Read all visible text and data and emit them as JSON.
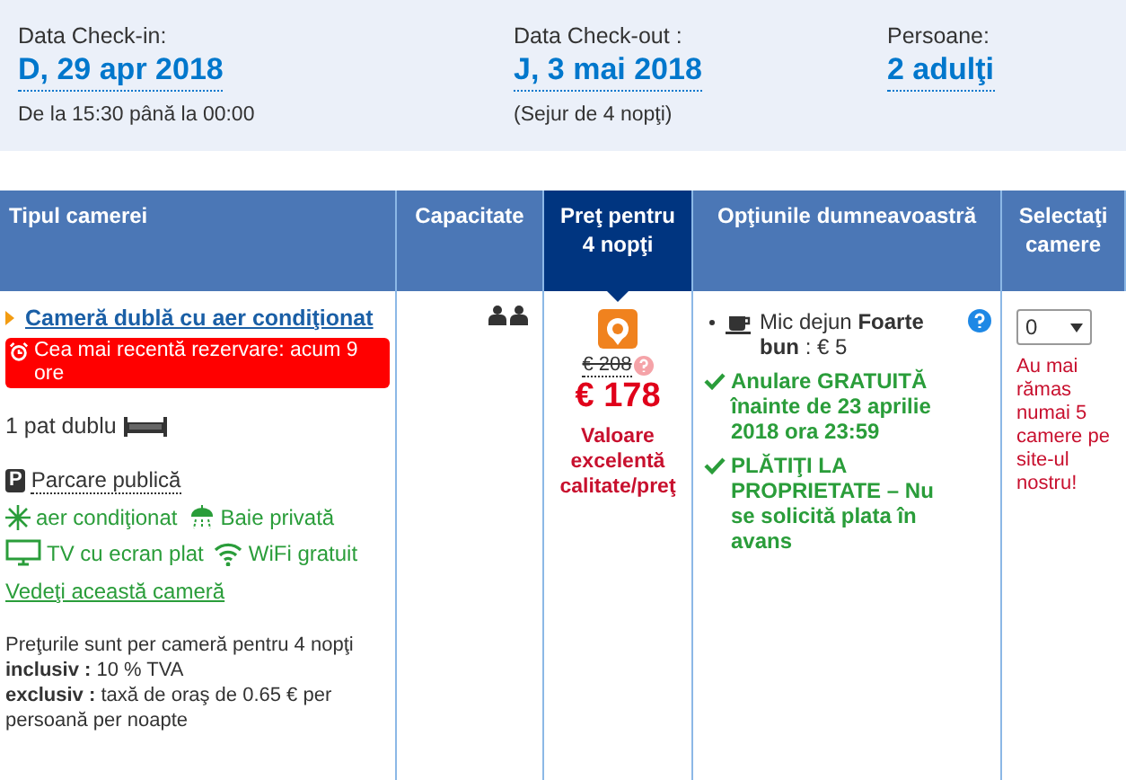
{
  "stay": {
    "checkin": {
      "label": "Data Check-in:",
      "value": "D, 29 apr 2018",
      "note": "De la 15:30 până la 00:00"
    },
    "checkout": {
      "label": "Data Check-out :",
      "value": "J, 3 mai 2018",
      "note": "(Sejur de 4 nopţi)"
    },
    "guests": {
      "label": "Persoane:",
      "value": "2 adulţi"
    }
  },
  "table": {
    "columns": [
      {
        "label": "Tipul camerei",
        "selected": false
      },
      {
        "label": "Capacitate",
        "selected": false
      },
      {
        "label": "Preţ pentru 4 nopţi",
        "selected": true
      },
      {
        "label": "Opţiunile dumneavoastră",
        "selected": false
      },
      {
        "label": "Selectaţi camere",
        "selected": false
      }
    ],
    "room": {
      "name": "Cameră dublă cu aer condiţionat",
      "recent_booking": "Cea mai recentă rezervare: acum 9 ore",
      "bed": "1 pat dublu",
      "parking_icon": "P",
      "parking": "Parcare publică",
      "facilities": [
        {
          "kind": "snowflake",
          "label": "aer condiţionat"
        },
        {
          "kind": "shower",
          "label": "Baie privată"
        },
        {
          "kind": "tv",
          "label": "TV cu ecran plat"
        },
        {
          "kind": "wifi",
          "label": "WiFi gratuit"
        }
      ],
      "view_link": "Vedeţi această cameră",
      "notes": [
        "Preţurile sunt per cameră pentru 4 nopţi",
        "**inclusiv :** 10 % TVA",
        "**exclusiv :** taxă de oraş de 0.65 € per persoană per noapte"
      ],
      "old_price": "€ 208",
      "price": "€ 178",
      "price_badge": "Valoare excelentă calitate/preţ",
      "conditions": [
        {
          "kind": "breakfast",
          "text": "Mic dejun **Foarte bun** : € 5"
        },
        {
          "kind": "check",
          "text": "Anulare GRATUITĂ înainte de 23 aprilie 2018 ora 23:59"
        },
        {
          "kind": "check",
          "text": "PLĂTIŢI LA PROPRIETATE – Nu se solicită plata în avans"
        }
      ],
      "quantity": "0",
      "availability": "Au mai rămas numai 5 camere pe site-ul nostru!"
    }
  }
}
